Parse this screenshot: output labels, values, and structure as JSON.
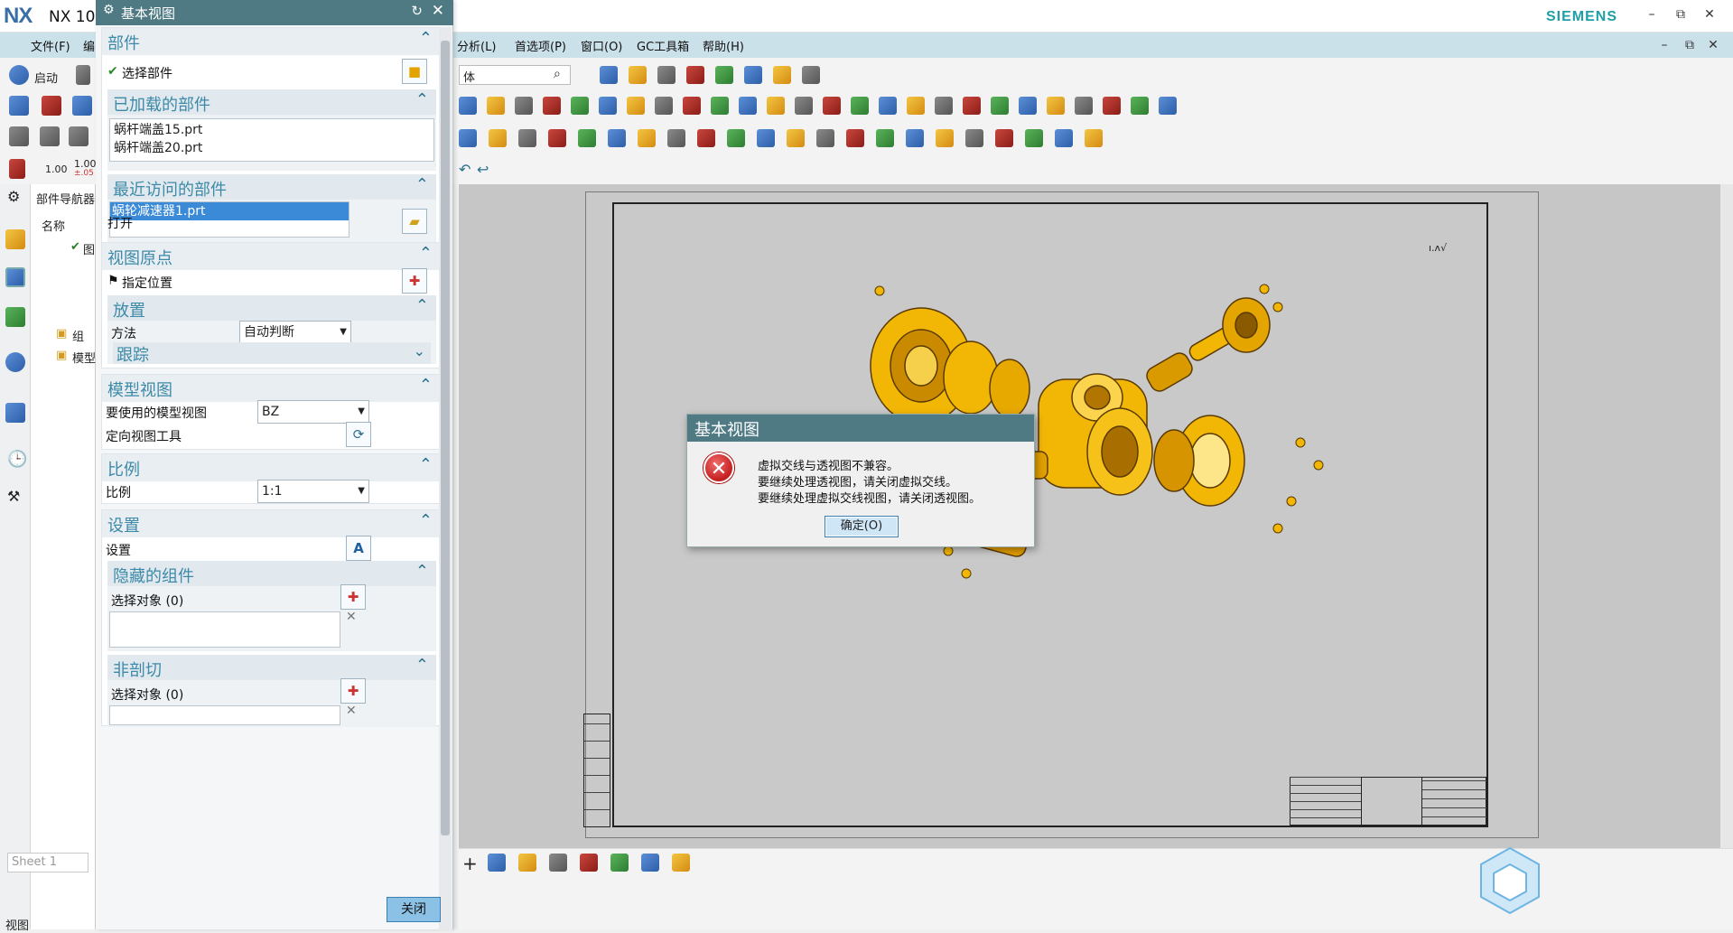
{
  "app": {
    "logo": "NX",
    "title": "NX 10",
    "brand": "SIEMENS",
    "window_buttons": [
      "–",
      "⧉",
      "✕"
    ]
  },
  "menu": {
    "items": [
      "文件(F)",
      "编",
      "分析(L)",
      "首选项(P)",
      "窗口(O)",
      "GC工具箱",
      "帮助(H)"
    ]
  },
  "toolbar": {
    "start_label": "启动",
    "scale_a": "1.00",
    "scale_b": "1.00",
    "scale_b_sub": "±.05",
    "search_value": "体"
  },
  "navigator": {
    "title": "部件导航器",
    "column_name": "名称",
    "nodes": [
      "图",
      "组",
      "模型"
    ],
    "sheet_placeholder": "Sheet 1",
    "bottom_label": "视图"
  },
  "dialog": {
    "title": "基本视图",
    "section_part": {
      "title": "部件",
      "select_part": "选择部件"
    },
    "loaded_parts": {
      "title": "已加载的部件",
      "items": [
        "蜗杆端盖15.prt",
        "蜗杆端盖20.prt"
      ]
    },
    "recent_parts": {
      "title": "最近访问的部件",
      "items": [
        "蜗轮减速器1.prt"
      ]
    },
    "open_label": "打开",
    "view_origin": {
      "title": "视图原点",
      "specify_location": "指定位置"
    },
    "placement": {
      "title": "放置",
      "method_label": "方法",
      "method_value": "自动判断",
      "tracking_title": "跟踪"
    },
    "model_view": {
      "title": "模型视图",
      "use_label": "要使用的模型视图",
      "use_value": "BZ",
      "orient_tool": "定向视图工具"
    },
    "scale": {
      "title": "比例",
      "label": "比例",
      "value": "1:1"
    },
    "settings": {
      "title": "设置",
      "label": "设置"
    },
    "hidden_components": {
      "title": "隐藏的组件",
      "select_label": "选择对象 (0)"
    },
    "non_section": {
      "title": "非剖切",
      "select_label": "选择对象 (0)"
    },
    "close_label": "关闭"
  },
  "message_box": {
    "title": "基本视图",
    "lines": [
      "虚拟交线与透视图不兼容。",
      "要继续处理透视图，请关闭虚拟交线。",
      "要继续处理虚拟交线视图，请关闭透视图。"
    ],
    "ok_label": "确定(O)"
  },
  "drawing": {
    "note": "ı.ʌ√"
  },
  "colors": {
    "title_bar": "#4f7a84",
    "section_text": "#3c8aa8",
    "brand": "#1f9fa8",
    "model_yellow": "#f2b705",
    "error_red": "#c41e1e"
  },
  "icons": [
    "gear-icon",
    "refresh-icon",
    "close-icon",
    "chevron-up-icon",
    "chevron-down-icon",
    "check-icon",
    "cube-icon",
    "folder-open-icon",
    "flag-icon",
    "crosshair-icon",
    "orient-view-icon",
    "settings-text-icon",
    "error-icon"
  ]
}
